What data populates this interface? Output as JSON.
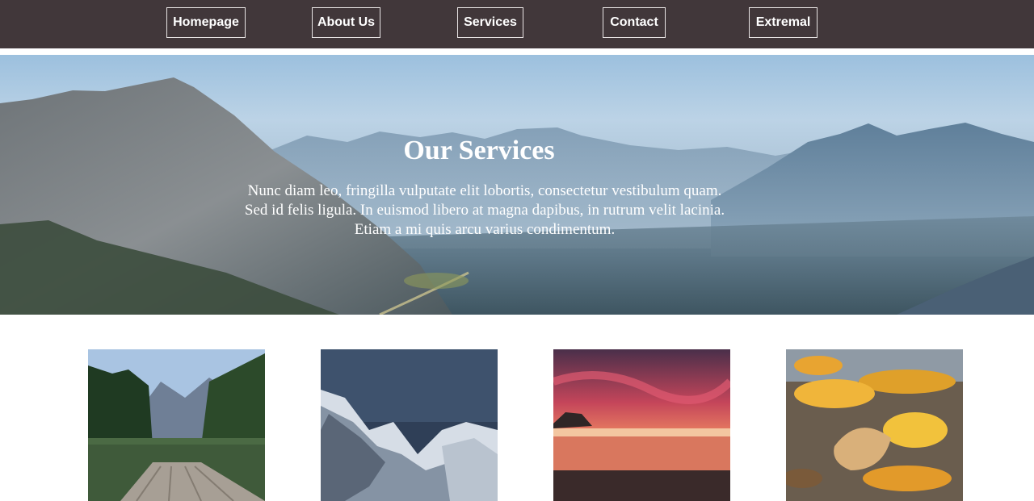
{
  "nav": {
    "items": [
      {
        "label": "Homepage"
      },
      {
        "label": "About Us"
      },
      {
        "label": "Services"
      },
      {
        "label": "Contact"
      },
      {
        "label": "Extremal"
      }
    ]
  },
  "hero": {
    "title": "Our Services",
    "text": "Nunc diam leo, fringilla vulputate elit lobortis, consectetur vestibulum quam. Sed id felis ligula. In euismod libero at magna dapibus, in rutrum velit lacinia. Etiam a mi quis arcu varius condimentum."
  },
  "cards": [
    {
      "image": "lake-pier-photo"
    },
    {
      "image": "snowy-mountain-photo"
    },
    {
      "image": "sunset-beach-photo"
    },
    {
      "image": "autumn-leaves-photo"
    }
  ],
  "colors": {
    "nav_background": "#41373a",
    "nav_border": "#e8e4e4",
    "text": "#ffffff"
  }
}
